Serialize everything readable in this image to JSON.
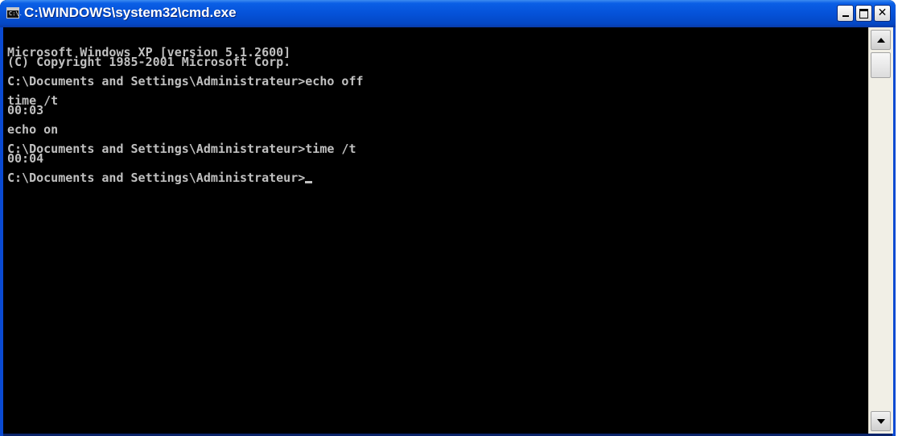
{
  "window": {
    "title": "C:\\WINDOWS\\system32\\cmd.exe",
    "icon": "cmd-icon",
    "icon_text": "C:\\."
  },
  "console": {
    "lines": [
      "Microsoft Windows XP [version 5.1.2600]",
      "(C) Copyright 1985-2001 Microsoft Corp.",
      "",
      "C:\\Documents and Settings\\Administrateur>echo off",
      "",
      "time /t",
      "00:03",
      "",
      "echo on",
      "",
      "C:\\Documents and Settings\\Administrateur>time /t",
      "00:04",
      "",
      "C:\\Documents and Settings\\Administrateur>"
    ]
  },
  "colors": {
    "console_bg": "#000000",
    "console_fg": "#c0c0c0",
    "titlebar": "#0552d8"
  }
}
